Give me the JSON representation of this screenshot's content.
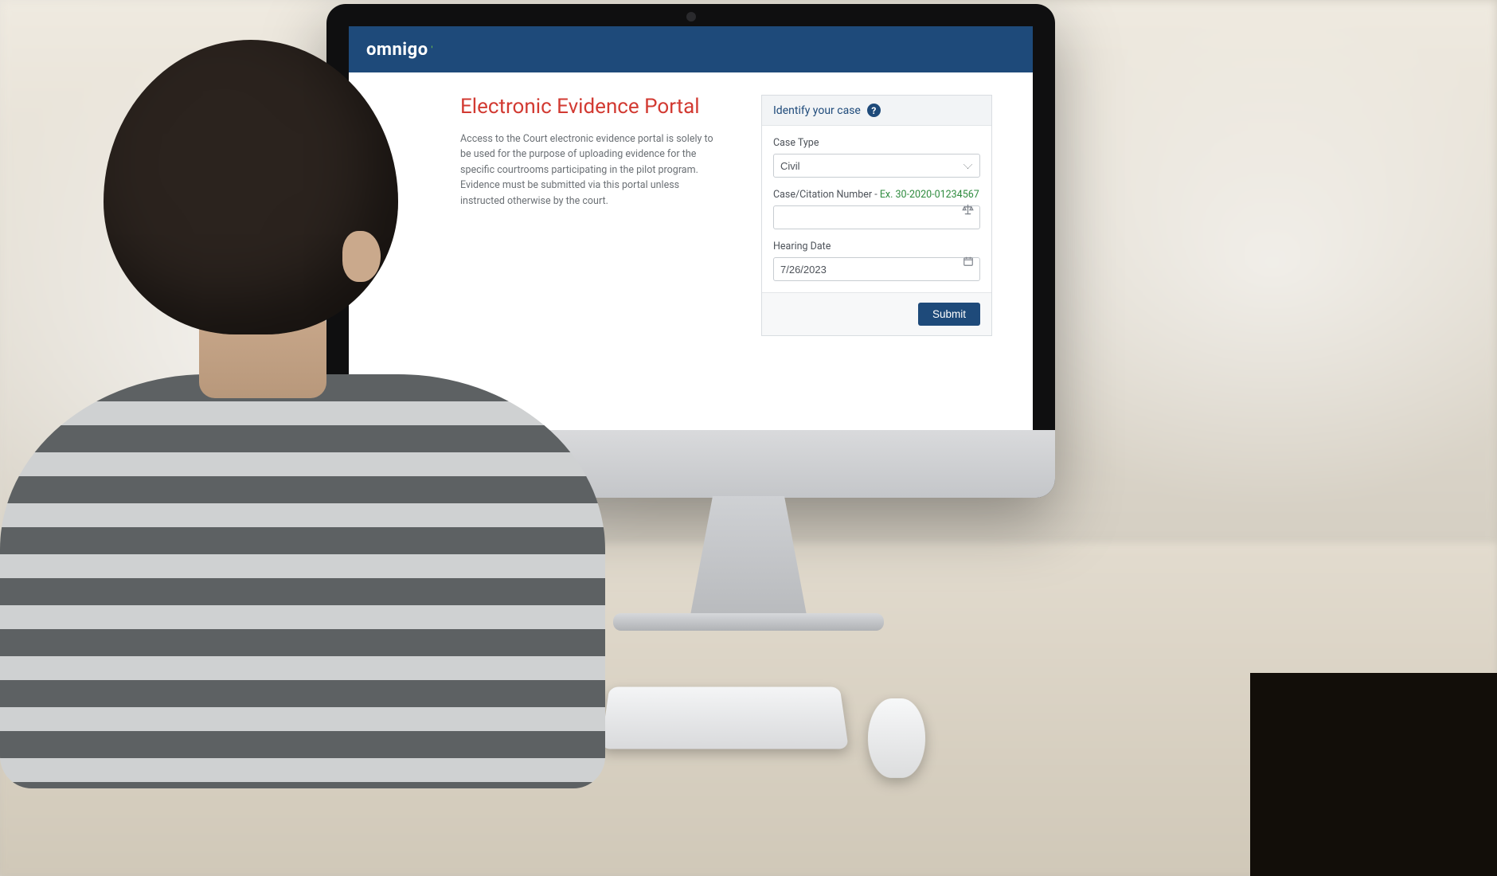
{
  "brand": {
    "name": "omnigo"
  },
  "page": {
    "title": "Electronic Evidence Portal",
    "intro": "Access to the Court electronic evidence portal is solely to be used for the purpose of uploading evidence for the specific courtrooms participating in the pilot program. Evidence must be submitted via this portal unless instructed otherwise by the court."
  },
  "form": {
    "card_title": "Identify your case",
    "help_icon_name": "help-icon",
    "case_type_label": "Case Type",
    "case_type_value": "Civil",
    "case_number_label_prefix": "Case/Citation Number - ",
    "case_number_example_prefix": "Ex. ",
    "case_number_example": "30-2020-01234567",
    "case_number_value": "",
    "hearing_date_label": "Hearing Date",
    "hearing_date_value": "7/26/2023",
    "submit_label": "Submit"
  },
  "colors": {
    "header": "#1e4a7a",
    "title": "#d23a32",
    "example": "#2e8b3e"
  }
}
